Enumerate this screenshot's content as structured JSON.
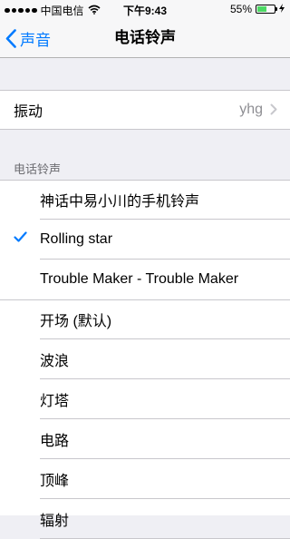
{
  "status_bar": {
    "carrier": "中国电信",
    "time": "下午9:43",
    "battery_percent": "55%",
    "battery_level": 0.55,
    "signal_dots": 5,
    "icons": [
      "signal-dots",
      "wifi-icon",
      "battery-icon",
      "charging-icon"
    ]
  },
  "nav": {
    "back_label": "声音",
    "title": "电话铃声"
  },
  "vibration": {
    "label": "振动",
    "value": "yhg"
  },
  "section_header": "电话铃声",
  "ringtones_custom": [
    {
      "label": "神话中易小川的手机铃声",
      "selected": false
    },
    {
      "label": "Rolling star",
      "selected": true
    },
    {
      "label": "Trouble Maker - Trouble Maker",
      "selected": false
    }
  ],
  "ringtones_builtin": [
    {
      "label": "开场 (默认)"
    },
    {
      "label": "波浪"
    },
    {
      "label": "灯塔"
    },
    {
      "label": "电路"
    },
    {
      "label": "顶峰"
    },
    {
      "label": "辐射"
    }
  ],
  "colors": {
    "accent": "#007aff",
    "background": "#efeff4",
    "separator": "#c8c7cc",
    "battery_fill": "#4cd964"
  }
}
